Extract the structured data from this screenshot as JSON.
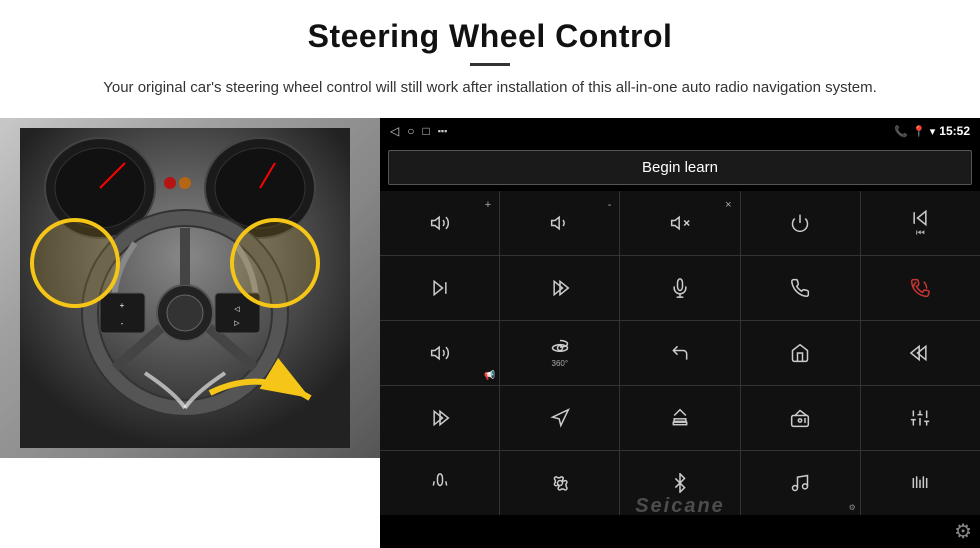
{
  "header": {
    "title": "Steering Wheel Control",
    "subtitle": "Your original car's steering wheel control will still work after installation of this all-in-one auto radio navigation system."
  },
  "status_bar": {
    "left_icons": [
      "back-arrow",
      "home-circle",
      "square"
    ],
    "right_icons": [
      "phone-icon",
      "location-icon",
      "wifi-icon",
      "battery-icon"
    ],
    "time": "15:52"
  },
  "begin_learn_button": "Begin learn",
  "controls": [
    {
      "icon": "vol-up",
      "unicode": "🔊+",
      "row": 1,
      "col": 1
    },
    {
      "icon": "vol-down",
      "unicode": "🔊-",
      "row": 1,
      "col": 2
    },
    {
      "icon": "mute",
      "unicode": "🔇",
      "row": 1,
      "col": 3
    },
    {
      "icon": "power",
      "unicode": "⏻",
      "row": 1,
      "col": 4
    },
    {
      "icon": "skip-back",
      "unicode": "⏮",
      "row": 1,
      "col": 5
    },
    {
      "icon": "next-track",
      "unicode": "⏭",
      "row": 2,
      "col": 1
    },
    {
      "icon": "fast-forward-skip",
      "unicode": "⏩",
      "row": 2,
      "col": 2
    },
    {
      "icon": "mic",
      "unicode": "🎤",
      "row": 2,
      "col": 3
    },
    {
      "icon": "phone-call",
      "unicode": "📞",
      "row": 2,
      "col": 4
    },
    {
      "icon": "phone-hang",
      "unicode": "📵",
      "row": 2,
      "col": 5
    },
    {
      "icon": "speaker",
      "unicode": "📢",
      "row": 3,
      "col": 1
    },
    {
      "icon": "360-view",
      "unicode": "360°",
      "row": 3,
      "col": 2
    },
    {
      "icon": "back",
      "unicode": "↩",
      "row": 3,
      "col": 3
    },
    {
      "icon": "home",
      "unicode": "⌂",
      "row": 3,
      "col": 4
    },
    {
      "icon": "rewind",
      "unicode": "⏮⏮",
      "row": 3,
      "col": 5
    },
    {
      "icon": "fast-fwd",
      "unicode": "⏭⏭",
      "row": 4,
      "col": 1
    },
    {
      "icon": "navigate",
      "unicode": "➤",
      "row": 4,
      "col": 2
    },
    {
      "icon": "eject",
      "unicode": "⏏",
      "row": 4,
      "col": 3
    },
    {
      "icon": "radio",
      "unicode": "📻",
      "row": 4,
      "col": 4
    },
    {
      "icon": "equalizer",
      "unicode": "🎚",
      "row": 4,
      "col": 5
    },
    {
      "icon": "microphone2",
      "unicode": "🎙",
      "row": 5,
      "col": 1
    },
    {
      "icon": "settings2",
      "unicode": "⚙",
      "row": 5,
      "col": 2
    },
    {
      "icon": "bluetooth",
      "unicode": "Ᵽ",
      "row": 5,
      "col": 3
    },
    {
      "icon": "music-note",
      "unicode": "♪",
      "row": 5,
      "col": 4
    },
    {
      "icon": "equalizer2",
      "unicode": "|||",
      "row": 5,
      "col": 5
    }
  ],
  "watermark": "Seicane",
  "gear_icon": "⚙"
}
